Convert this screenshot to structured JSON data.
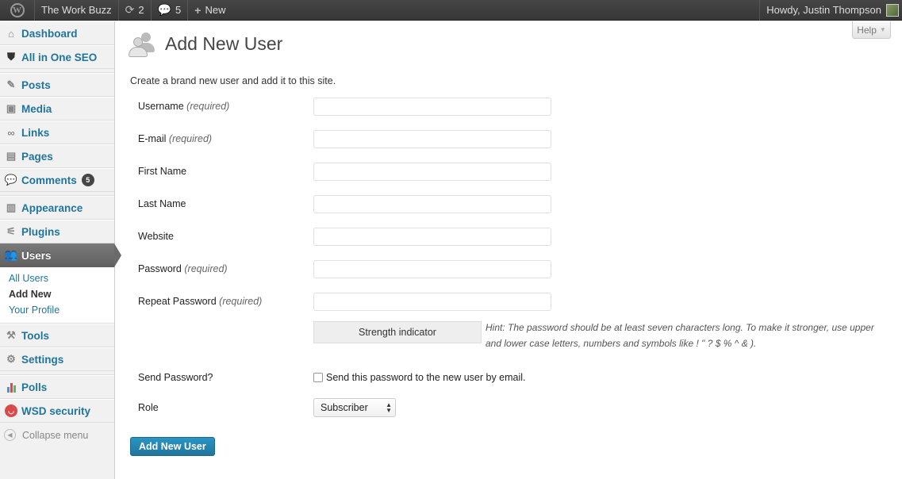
{
  "adminbar": {
    "site_name": "The Work Buzz",
    "updates_count": "2",
    "comments_count": "5",
    "new_label": "New",
    "howdy": "Howdy, Justin Thompson"
  },
  "sidebar": {
    "items": [
      {
        "label": "Dashboard"
      },
      {
        "label": "All in One SEO"
      },
      {
        "label": "Posts"
      },
      {
        "label": "Media"
      },
      {
        "label": "Links"
      },
      {
        "label": "Pages"
      },
      {
        "label": "Comments",
        "badge": "5"
      },
      {
        "label": "Appearance"
      },
      {
        "label": "Plugins"
      },
      {
        "label": "Users"
      },
      {
        "label": "Tools"
      },
      {
        "label": "Settings"
      },
      {
        "label": "Polls"
      },
      {
        "label": "WSD security"
      }
    ],
    "users_submenu": [
      "All Users",
      "Add New",
      "Your Profile"
    ],
    "collapse_label": "Collapse menu"
  },
  "help_label": "Help",
  "page": {
    "title": "Add New User",
    "intro": "Create a brand new user and add it to this site."
  },
  "form": {
    "required_note": "(required)",
    "username_label": "Username",
    "email_label": "E-mail",
    "first_name_label": "First Name",
    "last_name_label": "Last Name",
    "website_label": "Website",
    "password_label": "Password",
    "repeat_password_label": "Repeat Password",
    "username_value": "",
    "email_value": "",
    "first_name_value": "",
    "last_name_value": "",
    "website_value": "",
    "password_value": "",
    "repeat_password_value": "",
    "strength_label": "Strength indicator",
    "hint": "Hint: The password should be at least seven characters long. To make it stronger, use upper and lower case letters, numbers and symbols like ! \" ? $ % ^ & ).",
    "send_password_label": "Send Password?",
    "send_password_checkbox_label": "Send this password to the new user by email.",
    "send_password_checked": false,
    "role_label": "Role",
    "role_value": "Subscriber",
    "submit_label": "Add New User"
  },
  "colors": {
    "link": "#21759b",
    "adminbar": "#464646",
    "primary_button": "#21759b"
  }
}
